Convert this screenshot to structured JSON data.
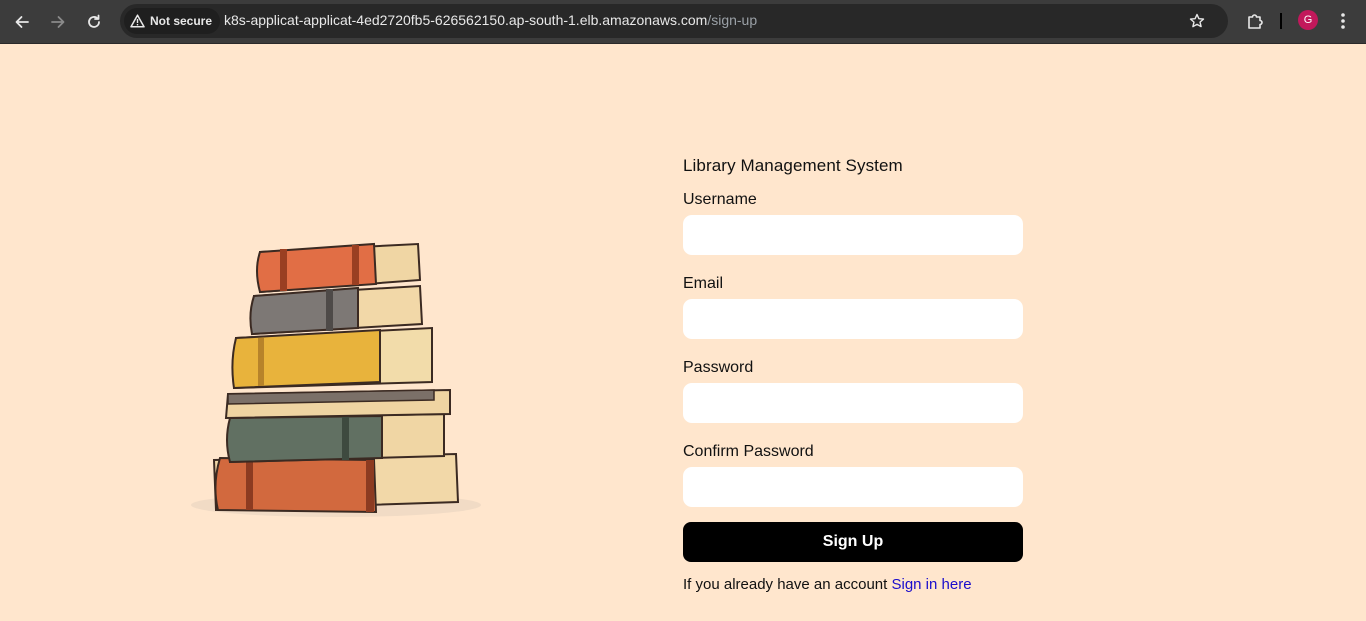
{
  "browser": {
    "security_label": "Not secure",
    "url_host": "k8s-applicat-applicat-4ed2720fb5-626562150.ap-south-1.elb.amazonaws.com",
    "url_path": "/sign-up",
    "avatar_letter": "G",
    "avatar_color": "#c2185b",
    "icons": [
      "back-icon",
      "forward-icon",
      "reload-icon",
      "warning-icon",
      "star-icon",
      "extensions-icon",
      "menu-icon"
    ]
  },
  "page": {
    "background": "#ffe6cd",
    "illustration": "stack-of-books"
  },
  "form": {
    "title": "Library Management System",
    "fields": [
      {
        "label": "Username",
        "value": "",
        "type": "text"
      },
      {
        "label": "Email",
        "value": "",
        "type": "email"
      },
      {
        "label": "Password",
        "value": "",
        "type": "password"
      },
      {
        "label": "Confirm Password",
        "value": "",
        "type": "password"
      }
    ],
    "submit_label": "Sign Up",
    "signin_prompt": "If you already have an account",
    "signin_link": "Sign in here"
  }
}
